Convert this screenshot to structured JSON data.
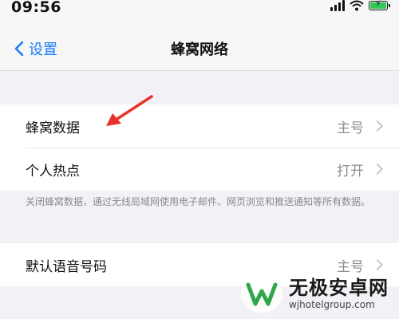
{
  "status_bar": {
    "time": "09:56",
    "icons": [
      "signal-icon",
      "wifi-icon",
      "battery-charging-icon"
    ]
  },
  "nav": {
    "back_label": "设置",
    "title": "蜂窝网络"
  },
  "cellular_group": {
    "items": [
      {
        "label": "蜂窝数据",
        "value": "主号"
      },
      {
        "label": "个人热点",
        "value": "打开"
      }
    ]
  },
  "footnote": "关闭蜂窝数据，通过无线局域网使用电子邮件、网页浏览和推送通知等所有数据。",
  "voice_group": {
    "label": "默认语音号码",
    "value": "主号"
  },
  "watermark": {
    "name": "无极安卓网",
    "url": "wjhotelgroup.com"
  },
  "colors": {
    "accent": "#1b7cf6",
    "annotation": "#e8322b",
    "battery": "#34c759"
  }
}
